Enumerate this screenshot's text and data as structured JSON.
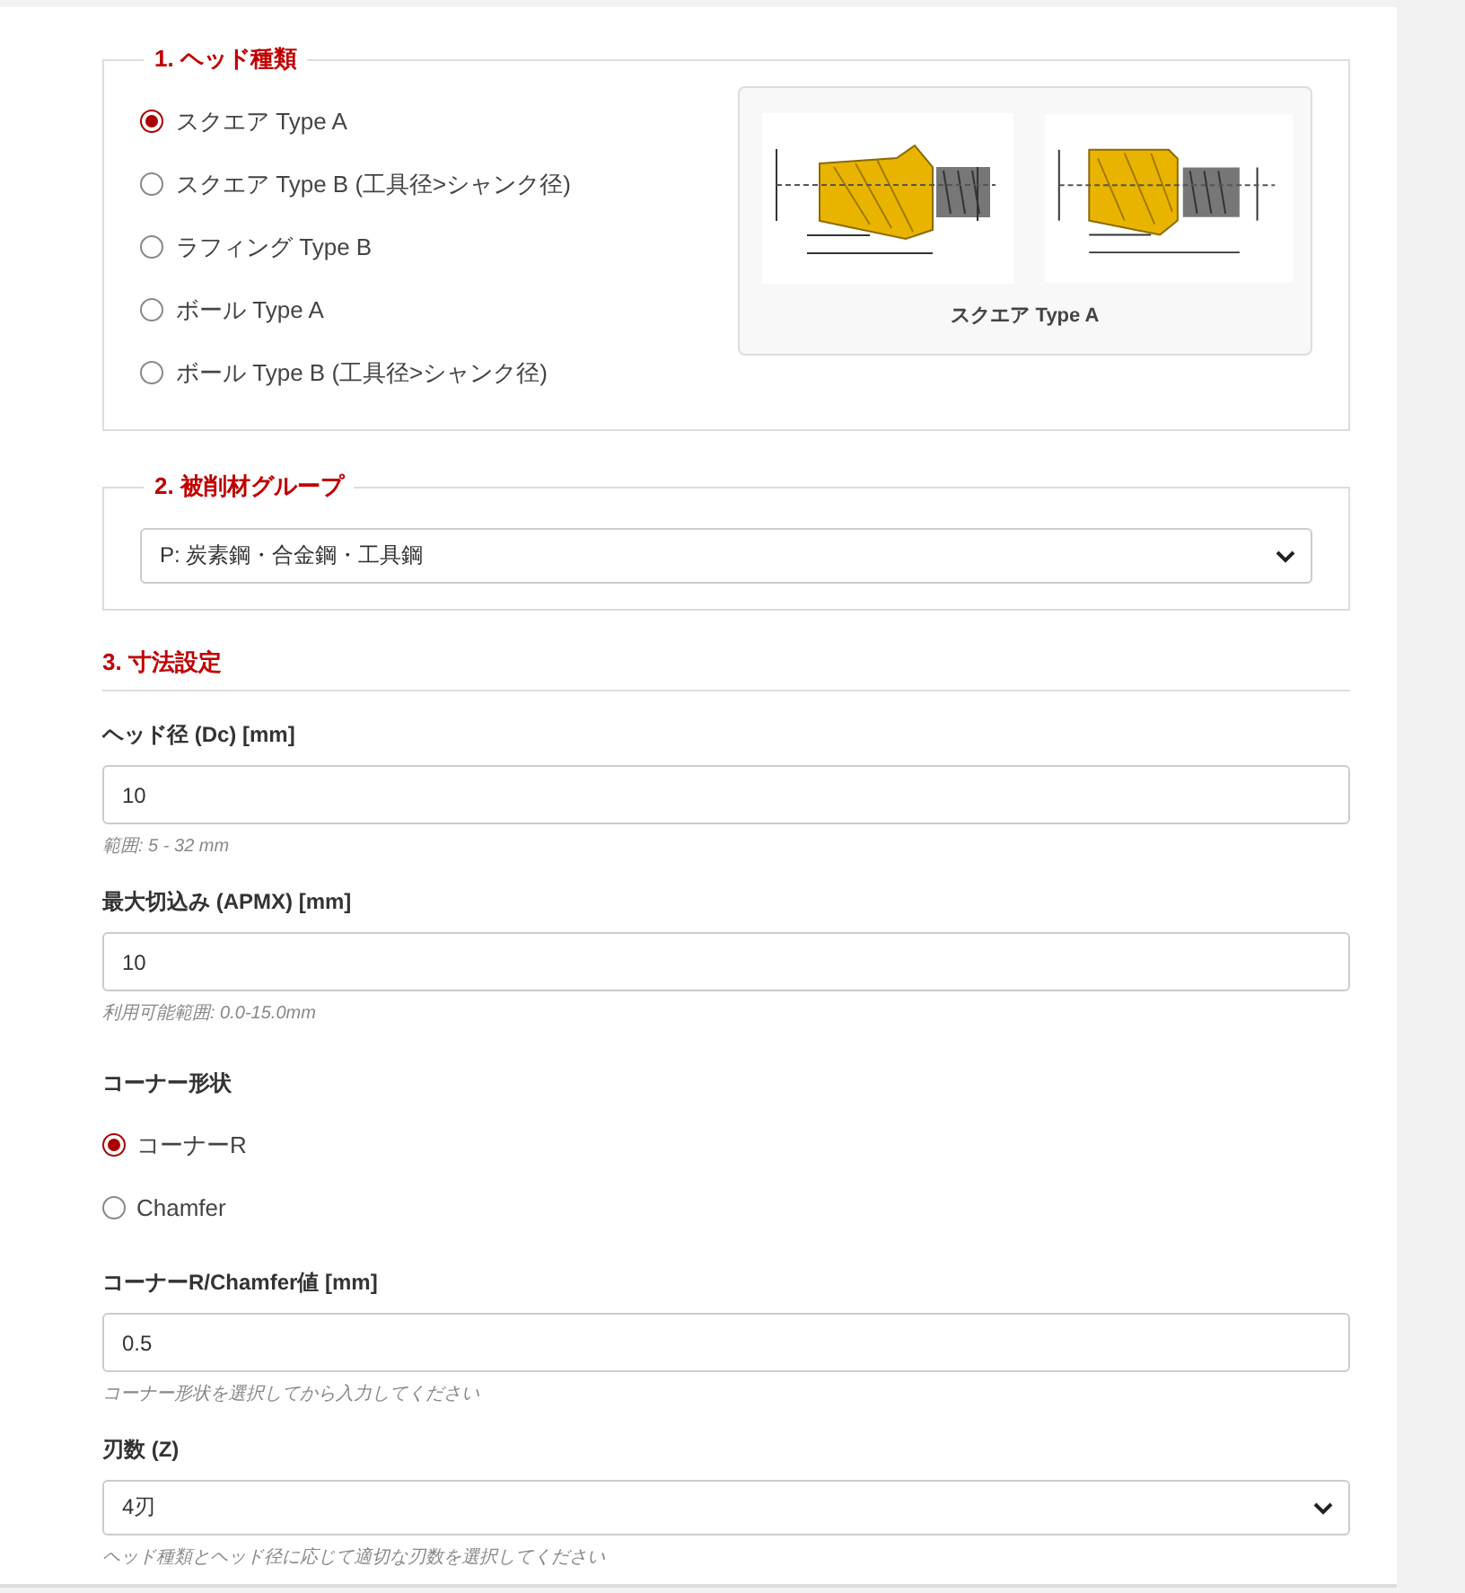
{
  "head_type": {
    "legend": "1. ヘッド種類",
    "options": [
      {
        "label": "スクエア Type A",
        "selected": true
      },
      {
        "label": "スクエア Type B (工具径>シャンク径)",
        "selected": false
      },
      {
        "label": "ラフィング Type B",
        "selected": false
      },
      {
        "label": "ボール Type A",
        "selected": false
      },
      {
        "label": "ボール Type B (工具径>シャンク径)",
        "selected": false
      }
    ],
    "figure": {
      "caption": "スクエア Type A"
    }
  },
  "material_group": {
    "legend": "2. 被削材グループ",
    "value": "P: 炭素鋼・合金鋼・工具鋼"
  },
  "dimensions": {
    "heading": "3. 寸法設定",
    "fields": [
      {
        "kind": "input",
        "label": "ヘッド径 (Dc) [mm]",
        "value": "10",
        "hint": "範囲: 5 - 32 mm"
      },
      {
        "kind": "input",
        "label": "最大切込み (APMX) [mm]",
        "value": "10",
        "hint": "利用可能範囲: 0.0-15.0mm"
      },
      {
        "kind": "radio",
        "label": "コーナー形状",
        "options": [
          {
            "label": "コーナーR",
            "selected": true
          },
          {
            "label": "Chamfer",
            "selected": false
          }
        ]
      },
      {
        "kind": "input",
        "label": "コーナーR/Chamfer値 [mm]",
        "value": "0.5",
        "hint": "コーナー形状を選択してから入力してください"
      },
      {
        "kind": "select",
        "label": "刃数 (Z)",
        "value": "4刃",
        "hint": "ヘッド種類とヘッド径に応じて適切な刃数を選択してください"
      }
    ]
  }
}
